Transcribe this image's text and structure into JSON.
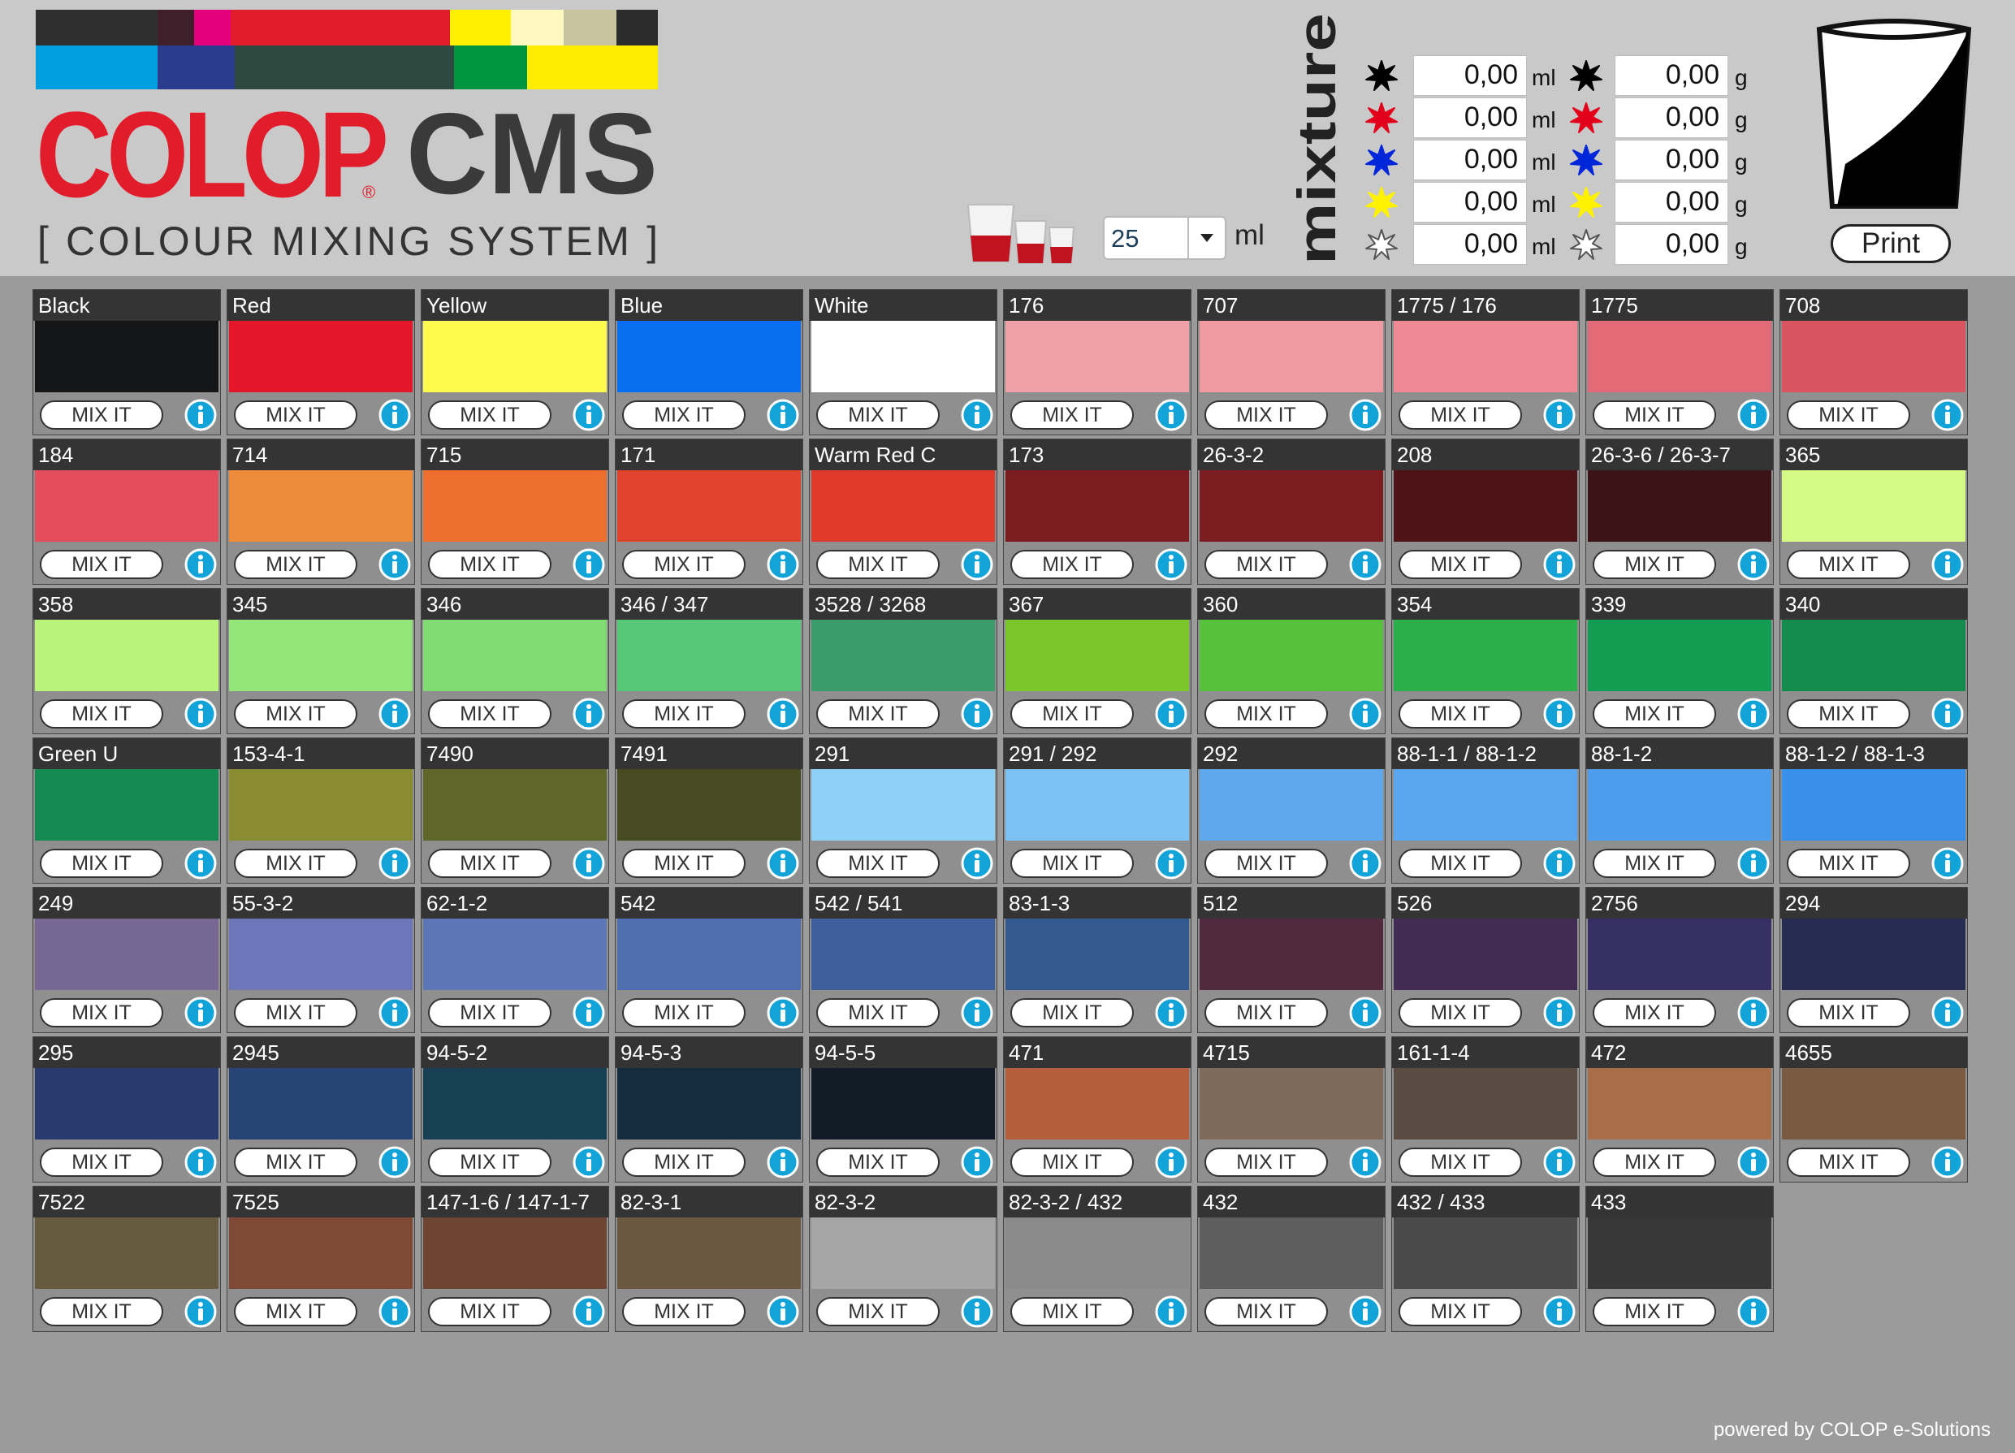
{
  "header": {
    "logo_colop": "COLOP",
    "logo_cms": "CMS",
    "logo_tagline": "[ COLOUR  MIXING  SYSTEM ]",
    "volume_value": "25",
    "volume_unit": "ml",
    "mixture_label": "mixture",
    "print_label": "Print"
  },
  "logo_bar_colors": [
    "#2f2f2f",
    "#3e1f2a",
    "#e4007d",
    "#e21d2b",
    "#fff000",
    "#fff7c0",
    "#c8c4a0",
    "#2c2c2c",
    "#00a0e0",
    "#2a3c8e",
    "#2e4a40",
    "#009640",
    "#ffed00"
  ],
  "mixture": [
    {
      "ink": "black",
      "color": "#000000",
      "ml": "0,00",
      "ml_unit": "ml",
      "g": "0,00",
      "g_unit": "g"
    },
    {
      "ink": "red",
      "color": "#e3001b",
      "ml": "0,00",
      "ml_unit": "ml",
      "g": "0,00",
      "g_unit": "g"
    },
    {
      "ink": "blue",
      "color": "#0026d9",
      "ml": "0,00",
      "ml_unit": "ml",
      "g": "0,00",
      "g_unit": "g"
    },
    {
      "ink": "yellow",
      "color": "#fff200",
      "ml": "0,00",
      "ml_unit": "ml",
      "g": "0,00",
      "g_unit": "g"
    },
    {
      "ink": "white",
      "color": "#ffffff",
      "ml": "0,00",
      "ml_unit": "ml",
      "g": "0,00",
      "g_unit": "g"
    }
  ],
  "tiles": [
    {
      "name": "Black",
      "color": "#141618"
    },
    {
      "name": "Red",
      "color": "#e4162a"
    },
    {
      "name": "Yellow",
      "color": "#fefb4e"
    },
    {
      "name": "Blue",
      "color": "#0a6ef0"
    },
    {
      "name": "White",
      "color": "#ffffff"
    },
    {
      "name": "176",
      "color": "#f0a1a8"
    },
    {
      "name": "707",
      "color": "#f19aa2"
    },
    {
      "name": "1775 / 176",
      "color": "#ef8a95"
    },
    {
      "name": "1775",
      "color": "#e46a78"
    },
    {
      "name": "708",
      "color": "#d8545f"
    },
    {
      "name": "184",
      "color": "#e44e5c"
    },
    {
      "name": "714",
      "color": "#ef8c3c"
    },
    {
      "name": "715",
      "color": "#ee6e2f"
    },
    {
      "name": "171",
      "color": "#e1432f"
    },
    {
      "name": "Warm Red C",
      "color": "#df3a2b"
    },
    {
      "name": "173",
      "color": "#7a1c20"
    },
    {
      "name": "26-3-2",
      "color": "#7c1e21"
    },
    {
      "name": "208",
      "color": "#4d1317"
    },
    {
      "name": "26-3-6 / 26-3-7",
      "color": "#3a1417"
    },
    {
      "name": "365",
      "color": "#d5fb86"
    },
    {
      "name": "358",
      "color": "#baf37a"
    },
    {
      "name": "345",
      "color": "#94e57a"
    },
    {
      "name": "346",
      "color": "#80dc72"
    },
    {
      "name": "346 / 347",
      "color": "#56c677"
    },
    {
      "name": "3528 / 3268",
      "color": "#3a9c6a"
    },
    {
      "name": "367",
      "color": "#7bc62a"
    },
    {
      "name": "360",
      "color": "#56c13a"
    },
    {
      "name": "354",
      "color": "#2aaf4a"
    },
    {
      "name": "339",
      "color": "#119e52"
    },
    {
      "name": "340",
      "color": "#138b4c"
    },
    {
      "name": "Green U",
      "color": "#148a52"
    },
    {
      "name": "153-4-1",
      "color": "#8a8c32"
    },
    {
      "name": "7490",
      "color": "#60662a"
    },
    {
      "name": "7491",
      "color": "#484a22"
    },
    {
      "name": "291",
      "color": "#8fd0f8"
    },
    {
      "name": "291 / 292",
      "color": "#7cc2f4"
    },
    {
      "name": "292",
      "color": "#5fa8ee"
    },
    {
      "name": "88-1-1 / 88-1-2",
      "color": "#5aa6ef"
    },
    {
      "name": "88-1-2",
      "color": "#4d9ded"
    },
    {
      "name": "88-1-2 / 88-1-3",
      "color": "#3990ea"
    },
    {
      "name": "249",
      "color": "#766892"
    },
    {
      "name": "55-3-2",
      "color": "#6c76b8"
    },
    {
      "name": "62-1-2",
      "color": "#5c76b6"
    },
    {
      "name": "542",
      "color": "#4e6eb0"
    },
    {
      "name": "542 / 541",
      "color": "#3f5e9c"
    },
    {
      "name": "83-1-3",
      "color": "#355a90"
    },
    {
      "name": "512",
      "color": "#522a40"
    },
    {
      "name": "526",
      "color": "#422c54"
    },
    {
      "name": "2756",
      "color": "#363064"
    },
    {
      "name": "294",
      "color": "#262c52"
    },
    {
      "name": "295",
      "color": "#283a6e"
    },
    {
      "name": "2945",
      "color": "#274476"
    },
    {
      "name": "94-5-2",
      "color": "#184054"
    },
    {
      "name": "94-5-3",
      "color": "#142c3e"
    },
    {
      "name": "94-5-5",
      "color": "#121c26"
    },
    {
      "name": "471",
      "color": "#b55e3c"
    },
    {
      "name": "4715",
      "color": "#7e6a5a"
    },
    {
      "name": "161-1-4",
      "color": "#5a4c42"
    },
    {
      "name": "472",
      "color": "#a86e4a"
    },
    {
      "name": "4655",
      "color": "#7a5a40"
    },
    {
      "name": "7522",
      "color": "#665b3e"
    },
    {
      "name": "7525",
      "color": "#7e4a36"
    },
    {
      "name": "147-1-6 / 147-1-7",
      "color": "#6e4432"
    },
    {
      "name": "82-3-1",
      "color": "#6a5840"
    },
    {
      "name": "82-3-2",
      "color": "#a6a6a6"
    },
    {
      "name": "82-3-2 / 432",
      "color": "#8a8a8a"
    },
    {
      "name": "432",
      "color": "#5e5e5e"
    },
    {
      "name": "432 / 433",
      "color": "#4a4a4a"
    },
    {
      "name": "433",
      "color": "#383838"
    }
  ],
  "mix_label": "MIX IT",
  "footer": "powered by COLOP e-Solutions"
}
